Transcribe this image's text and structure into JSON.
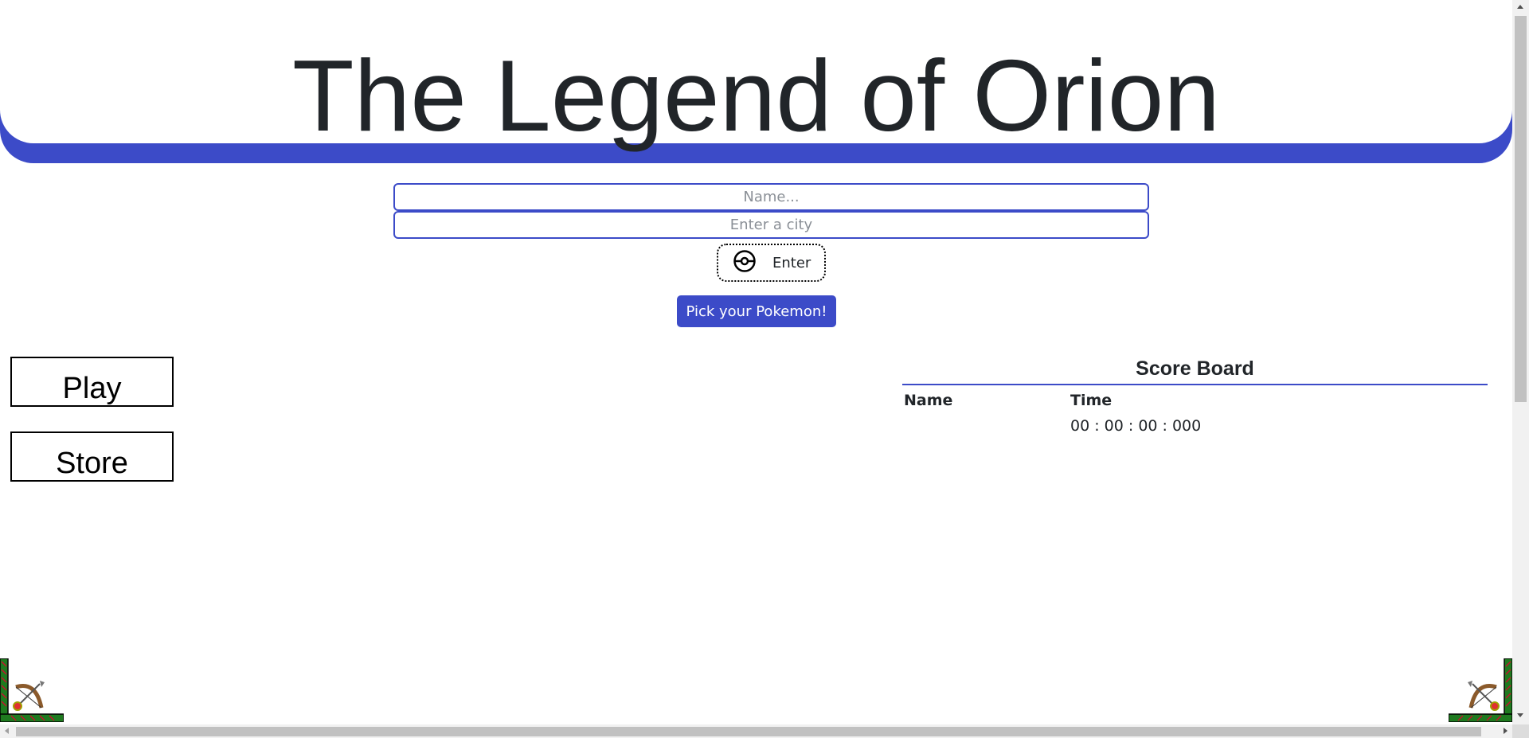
{
  "header": {
    "title": "The Legend of Orion"
  },
  "form": {
    "name_placeholder": "Name...",
    "city_placeholder": "Enter a city",
    "enter_label": "Enter",
    "enter_icon": "pokeball-icon",
    "pick_label": "Pick your Pokemon!"
  },
  "menu": {
    "play_label": "Play",
    "store_label": "Store"
  },
  "scoreboard": {
    "title": "Score Board",
    "columns": [
      "Name",
      "Time"
    ],
    "rows": [
      {
        "name": "",
        "time": "00 : 00 : 00 : 000"
      }
    ]
  },
  "colors": {
    "accent": "#3c4bc8",
    "text": "#212529"
  },
  "decor": {
    "corner_icon": "archer-bow-corner-icon"
  }
}
